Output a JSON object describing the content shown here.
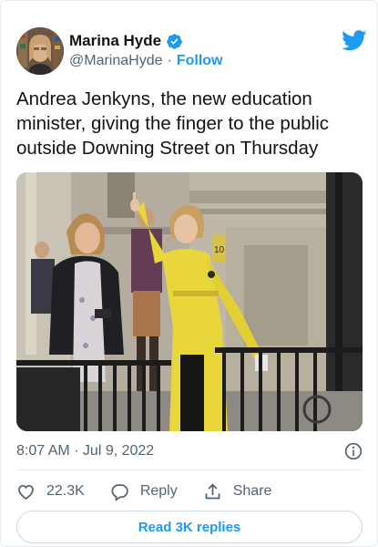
{
  "author": {
    "display_name": "Marina Hyde",
    "handle": "@MarinaHyde",
    "separator": "·",
    "follow_label": "Follow",
    "verified": true
  },
  "tweet": {
    "text": "Andrea Jenkyns, the new education minister, giving the finger to the public outside Downing Street on Thursday",
    "timestamp": "8:07 AM · Jul 9, 2022"
  },
  "media": {
    "sign_text": "10"
  },
  "actions": {
    "likes_count": "22.3K",
    "reply_label": "Reply",
    "share_label": "Share"
  },
  "replies_button": {
    "label": "Read 3K replies"
  },
  "colors": {
    "accent": "#1d9bf0",
    "text_primary": "#0f1419",
    "text_secondary": "#536471",
    "border": "#e6ecf0",
    "yellow_dress": "#e8d63a"
  },
  "icons": {
    "brand": "twitter-bird-icon",
    "verified": "verified-badge-icon",
    "info": "info-icon",
    "like": "heart-icon",
    "reply": "reply-bubble-icon",
    "share": "share-upload-icon"
  }
}
